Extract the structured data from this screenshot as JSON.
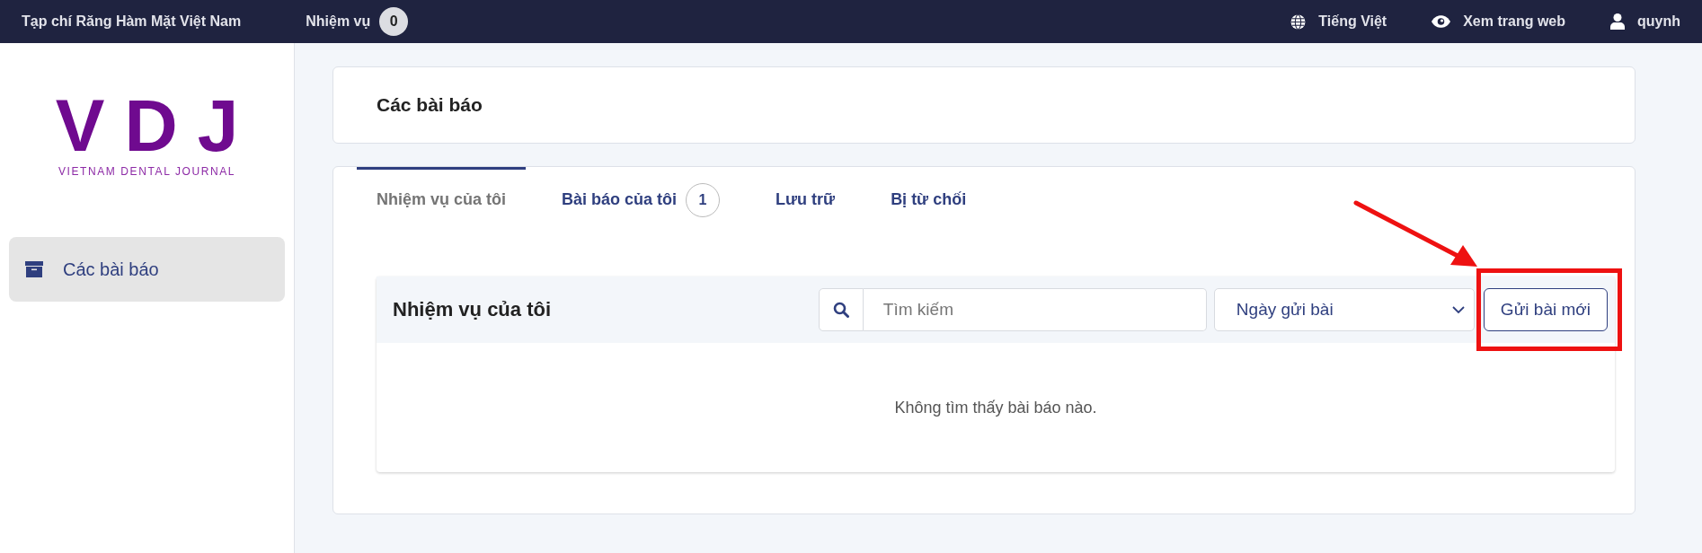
{
  "top_bar": {
    "site_title": "Tạp chí Răng Hàm Mặt Việt Nam",
    "tasks": {
      "label": "Nhiệm vụ",
      "count": "0"
    },
    "right_items": [
      {
        "kind": "language",
        "label": "Tiếng Việt"
      },
      {
        "kind": "view",
        "label": "Xem trang web"
      },
      {
        "kind": "user",
        "label": "quynh"
      }
    ]
  },
  "sidebar": {
    "logo": {
      "mark": "VDJ",
      "tagline": "VIETNAM DENTAL JOURNAL"
    },
    "items": [
      {
        "label": "Các bài báo",
        "selected": true
      }
    ]
  },
  "page_header": {
    "title": "Các bài báo"
  },
  "tabs": [
    {
      "label": "Nhiệm vụ của tôi",
      "selected": true
    },
    {
      "label": "Bài báo của tôi",
      "selected": false,
      "count": "1"
    },
    {
      "label": "Lưu trữ",
      "selected": false
    },
    {
      "label": "Bị từ chối",
      "selected": false
    }
  ],
  "list_panel": {
    "title": "Nhiệm vụ của tôi",
    "search": {
      "placeholder": "Tìm kiếm"
    },
    "sort": {
      "value": "Ngày gửi bài"
    },
    "new_button": "Gửi bài mới",
    "highlighted": true,
    "empty_message": "Không tìm thấy bài báo nào."
  }
}
